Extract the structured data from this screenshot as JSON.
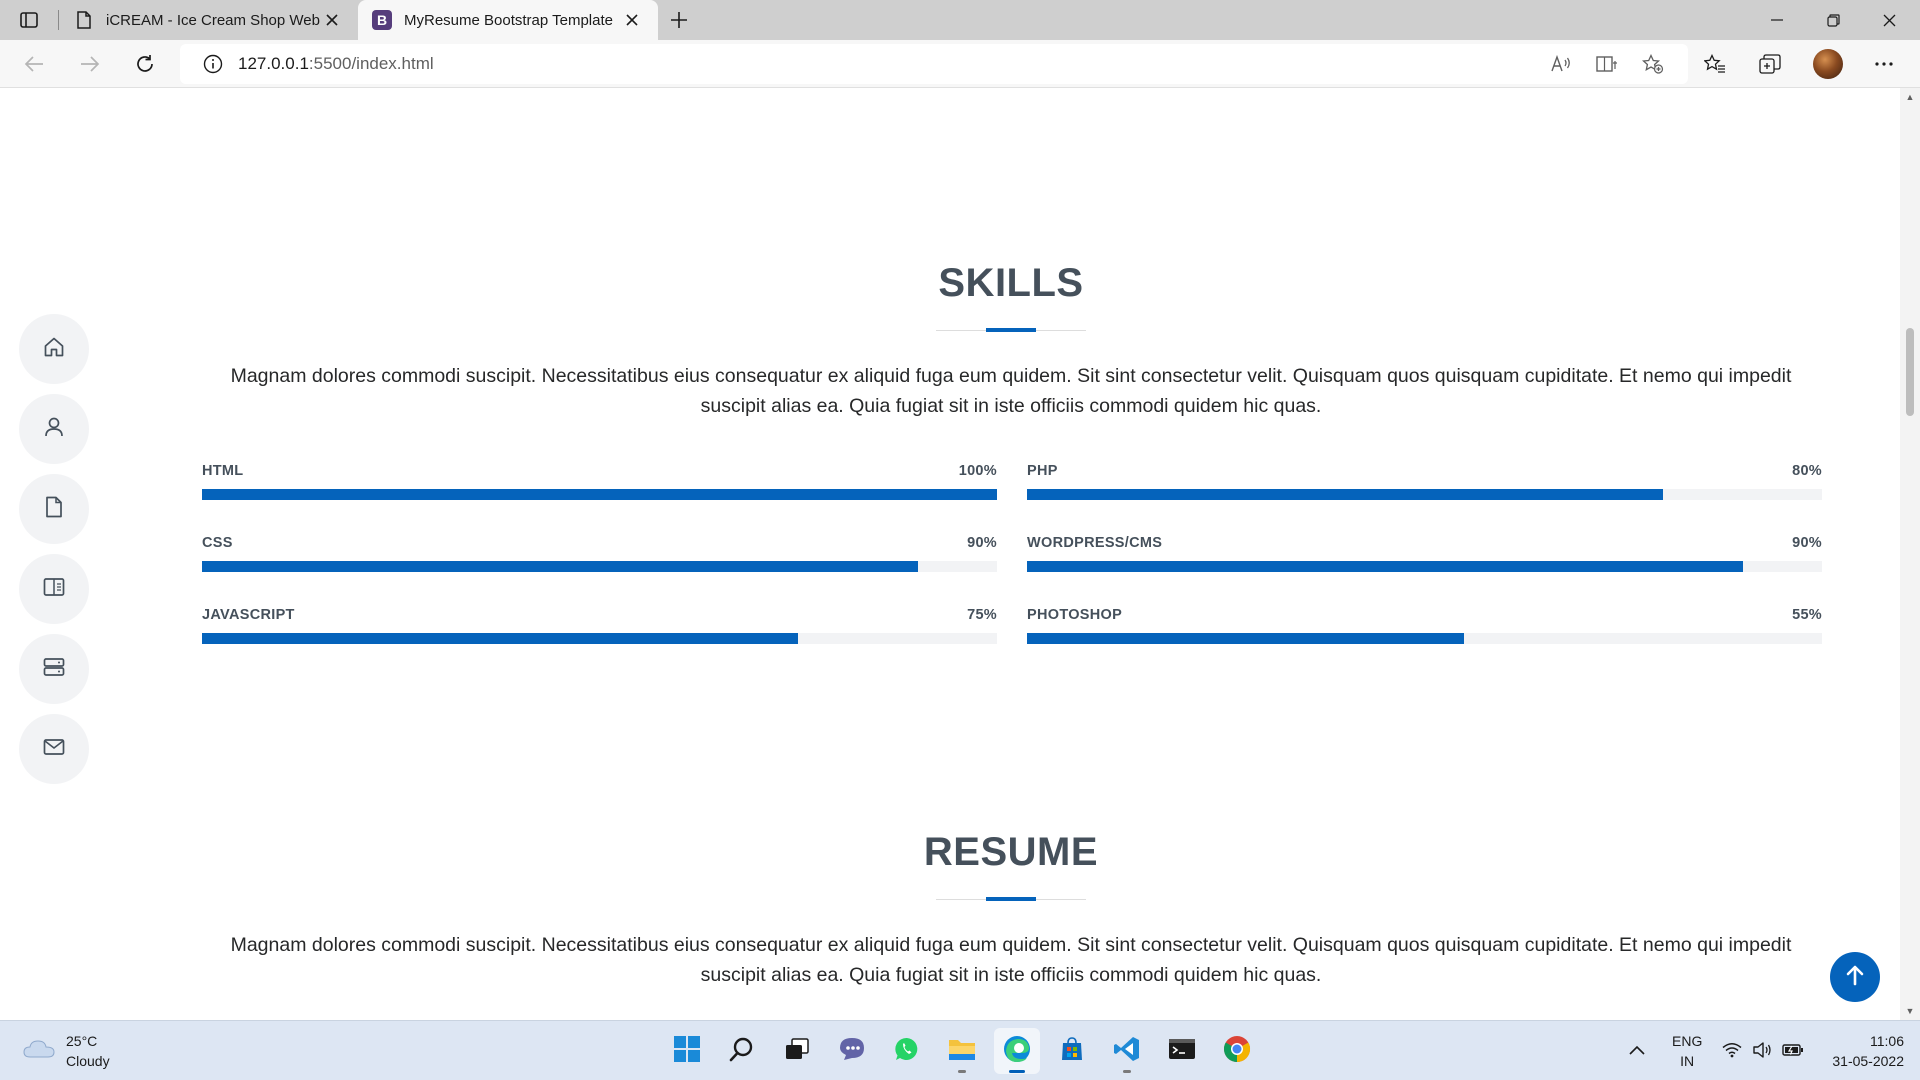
{
  "browser": {
    "tabs": [
      {
        "title": "iCREAM - Ice Cream Shop Website",
        "favicon": "page-icon",
        "active": false
      },
      {
        "title": "MyResume Bootstrap Template",
        "favicon": "bootstrap-icon",
        "active": true
      }
    ],
    "favicon_letter": "B",
    "url_host": "127.0.0.1",
    "url_path": ":5500/index.html"
  },
  "skills": {
    "title": "SKILLS",
    "description": "Magnam dolores commodi suscipit. Necessitatibus eius consequatur ex aliquid fuga eum quidem. Sit sint consectetur velit. Quisquam quos quisquam cupiditate. Et nemo qui impedit suscipit alias ea. Quia fugiat sit in iste officiis commodi quidem hic quas.",
    "left": [
      {
        "name": "HTML",
        "label": "100%",
        "value": 100
      },
      {
        "name": "CSS",
        "label": "90%",
        "value": 90
      },
      {
        "name": "JAVASCRIPT",
        "label": "75%",
        "value": 75
      }
    ],
    "right": [
      {
        "name": "PHP",
        "label": "80%",
        "value": 80
      },
      {
        "name": "WORDPRESS/CMS",
        "label": "90%",
        "value": 90
      },
      {
        "name": "PHOTOSHOP",
        "label": "55%",
        "value": 55
      }
    ]
  },
  "resume": {
    "title": "RESUME",
    "description": "Magnam dolores commodi suscipit. Necessitatibus eius consequatur ex aliquid fuga eum quidem. Sit sint consectetur velit. Quisquam quos quisquam cupiditate. Et nemo qui impedit suscipit alias ea. Quia fugiat sit in iste officiis commodi quidem hic quas."
  },
  "sidenav": [
    "home-icon",
    "user-icon",
    "file-icon",
    "book-icon",
    "server-icon",
    "envelope-icon"
  ],
  "colors": {
    "accent": "#0563bb",
    "heading": "#45505b",
    "track": "#f2f3f5"
  },
  "taskbar": {
    "weather_temp": "25°C",
    "weather_desc": "Cloudy",
    "lang_top": "ENG",
    "lang_bottom": "IN",
    "time": "11:06",
    "date": "31-05-2022"
  }
}
